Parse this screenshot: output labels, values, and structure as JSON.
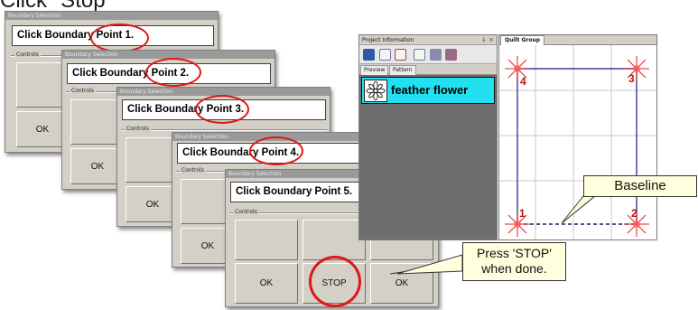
{
  "heading": {
    "text": "Click \"Stop\""
  },
  "dialogs": [
    {
      "title": "Boundary Selection",
      "prompt_prefix": "Click Boundary ",
      "prompt_point": "Point 1.",
      "controls_label": "Controls",
      "ok_label": "OK"
    },
    {
      "title": "Boundary Selection",
      "prompt_prefix": "Click Boundary ",
      "prompt_point": "Point 2.",
      "controls_label": "Controls",
      "ok_label": "OK"
    },
    {
      "title": "Boundary Selection",
      "prompt_prefix": "Click Boundary ",
      "prompt_point": "Point 3.",
      "controls_label": "Controls",
      "ok_label": "OK"
    },
    {
      "title": "Boundary Selection",
      "prompt_prefix": "Click Boundary ",
      "prompt_point": "Point 4.",
      "controls_label": "Controls",
      "ok_label": "OK"
    },
    {
      "title": "Boundary Selection",
      "prompt": "Click Boundary Point 5.",
      "controls_label": "Controls",
      "ok_label": "OK",
      "stop_label": "STOP",
      "ok2_label": "OK"
    }
  ],
  "project_panel": {
    "title": "Project Information",
    "title_controls": "↓ ×",
    "tabs": [
      "Preview",
      "Pattern"
    ],
    "pattern_name": "feather flower",
    "toolbar_icons": [
      "save-icon",
      "add-pattern-icon",
      "remove-pattern-icon",
      "copy-icon",
      "group-icon",
      "ungroup-icon"
    ]
  },
  "quilt_panel": {
    "tab": "Quilt Group",
    "corner_labels": [
      "1",
      "2",
      "3",
      "4"
    ]
  },
  "callouts": {
    "baseline": "Baseline",
    "stop_line1": "Press 'STOP'",
    "stop_line2": "when done."
  },
  "colors": {
    "dialog_bg": "#d4d0c8",
    "highlight_ring": "#e01616",
    "pattern_row": "#22e0f0",
    "quilt_line": "#3a3aa0",
    "corner_label": "#c01010",
    "callout_bg": "#ffffdd"
  }
}
